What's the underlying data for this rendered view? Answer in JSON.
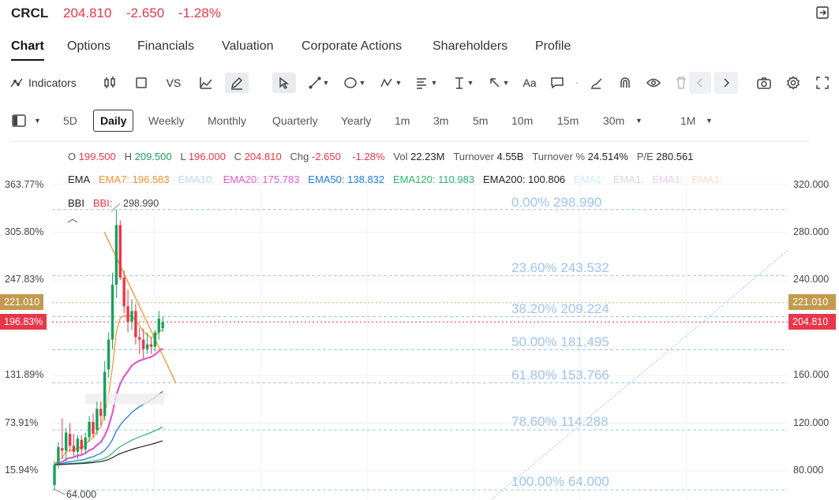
{
  "header": {
    "symbol": "CRCL",
    "price": "204.810",
    "change": "-2.650",
    "change_pct": "-1.28%"
  },
  "tabs": [
    "Chart",
    "Options",
    "Financials",
    "Valuation",
    "Corporate Actions",
    "Shareholders",
    "Profile"
  ],
  "toolbar": {
    "indicators_label": "Indicators",
    "vs_label": "VS",
    "text_label": "Aa"
  },
  "intervals": [
    "5D",
    "Daily",
    "Weekly",
    "Monthly",
    "Quarterly",
    "Yearly",
    "1m",
    "3m",
    "5m",
    "10m",
    "15m",
    "30m",
    "1M"
  ],
  "ohlc": {
    "o_label": "O",
    "o": "199.500",
    "h_label": "H",
    "h": "209.500",
    "l_label": "L",
    "l": "196.000",
    "c_label": "C",
    "c": "204.810",
    "chg_label": "Chg",
    "chg": "-2.650",
    "chg_pct": "-1.28%",
    "vol_label": "Vol",
    "vol": "22.23M",
    "turnover_label": "Turnover",
    "turnover": "4.55B",
    "turnover_pct_label": "Turnover %",
    "turnover_pct": "24.514%",
    "pe_label": "P/E",
    "pe": "280.561"
  },
  "ema": {
    "label": "EMA",
    "ema7": "EMA7: 196.583",
    "ema10": "EMA10:",
    "ema20": "EMA20: 175.783",
    "ema50": "EMA50: 138.832",
    "ema120": "EMA120: 110.983",
    "ema200": "EMA200: 100.806",
    "ema_x1": "EMA1:",
    "ema_x2": "EMA1:",
    "ema_x3": "EMA1:",
    "ema_x4": "EMA1:"
  },
  "bbi": {
    "label": "BBI",
    "value": "BBI:"
  },
  "chart_data": {
    "type": "candlestick",
    "high_label": "298.990",
    "low_label": "64.000",
    "left_axis": [
      "363.77%",
      "305.80%",
      "247.83%",
      "131.89%",
      "73.91%",
      "15.94%"
    ],
    "right_axis": [
      "320.000",
      "280.000",
      "240.000",
      "160.000",
      "120.000",
      "80.000"
    ],
    "left_axis_partial": "196.83%",
    "last_price_tag": "204.810",
    "level_tag": "221.010",
    "pct_tag": "196.83%",
    "fib_levels": [
      "0.00% 298.990",
      "23.60% 243.532",
      "38.20% 209.224",
      "50.00% 181.495",
      "61.80% 153.766",
      "78.60% 114.288",
      "100.00% 64.000"
    ],
    "colors": {
      "up": "#1aa05b",
      "down": "#e8364a",
      "ema7": "#f0932b",
      "ema20": "#e05ad0",
      "ema50": "#1f7be0",
      "ema120": "#2ab36b",
      "ema200": "#222222",
      "fib": "#9fc3ef"
    },
    "candles": [
      {
        "o": 68,
        "h": 88,
        "l": 64,
        "c": 85
      },
      {
        "o": 86,
        "h": 104,
        "l": 82,
        "c": 100
      },
      {
        "o": 99,
        "h": 124,
        "l": 90,
        "c": 97
      },
      {
        "o": 97,
        "h": 116,
        "l": 88,
        "c": 112
      },
      {
        "o": 111,
        "h": 120,
        "l": 96,
        "c": 101
      },
      {
        "o": 101,
        "h": 111,
        "l": 92,
        "c": 96
      },
      {
        "o": 96,
        "h": 110,
        "l": 90,
        "c": 107
      },
      {
        "o": 106,
        "h": 110,
        "l": 94,
        "c": 98
      },
      {
        "o": 98,
        "h": 112,
        "l": 94,
        "c": 108
      },
      {
        "o": 108,
        "h": 126,
        "l": 104,
        "c": 121
      },
      {
        "o": 121,
        "h": 128,
        "l": 108,
        "c": 111
      },
      {
        "o": 114,
        "h": 138,
        "l": 110,
        "c": 132
      },
      {
        "o": 132,
        "h": 138,
        "l": 118,
        "c": 126
      },
      {
        "o": 126,
        "h": 172,
        "l": 122,
        "c": 163
      },
      {
        "o": 165,
        "h": 196,
        "l": 158,
        "c": 190
      },
      {
        "o": 190,
        "h": 246,
        "l": 182,
        "c": 236
      },
      {
        "o": 236,
        "h": 298.99,
        "l": 225,
        "c": 286
      },
      {
        "o": 286,
        "h": 290,
        "l": 240,
        "c": 242
      },
      {
        "o": 242,
        "h": 248,
        "l": 212,
        "c": 218
      },
      {
        "o": 218,
        "h": 232,
        "l": 196,
        "c": 205
      },
      {
        "o": 205,
        "h": 224,
        "l": 198,
        "c": 214
      },
      {
        "o": 214,
        "h": 220,
        "l": 186,
        "c": 192
      },
      {
        "o": 192,
        "h": 200,
        "l": 178,
        "c": 190
      },
      {
        "o": 190,
        "h": 199,
        "l": 174,
        "c": 182
      },
      {
        "o": 182,
        "h": 196,
        "l": 178,
        "c": 186
      },
      {
        "o": 186,
        "h": 192,
        "l": 178,
        "c": 184
      },
      {
        "o": 184,
        "h": 198,
        "l": 180,
        "c": 196
      },
      {
        "o": 196,
        "h": 214,
        "l": 190,
        "c": 207.5
      },
      {
        "o": 199.5,
        "h": 209.5,
        "l": 196,
        "c": 204.81
      }
    ]
  }
}
